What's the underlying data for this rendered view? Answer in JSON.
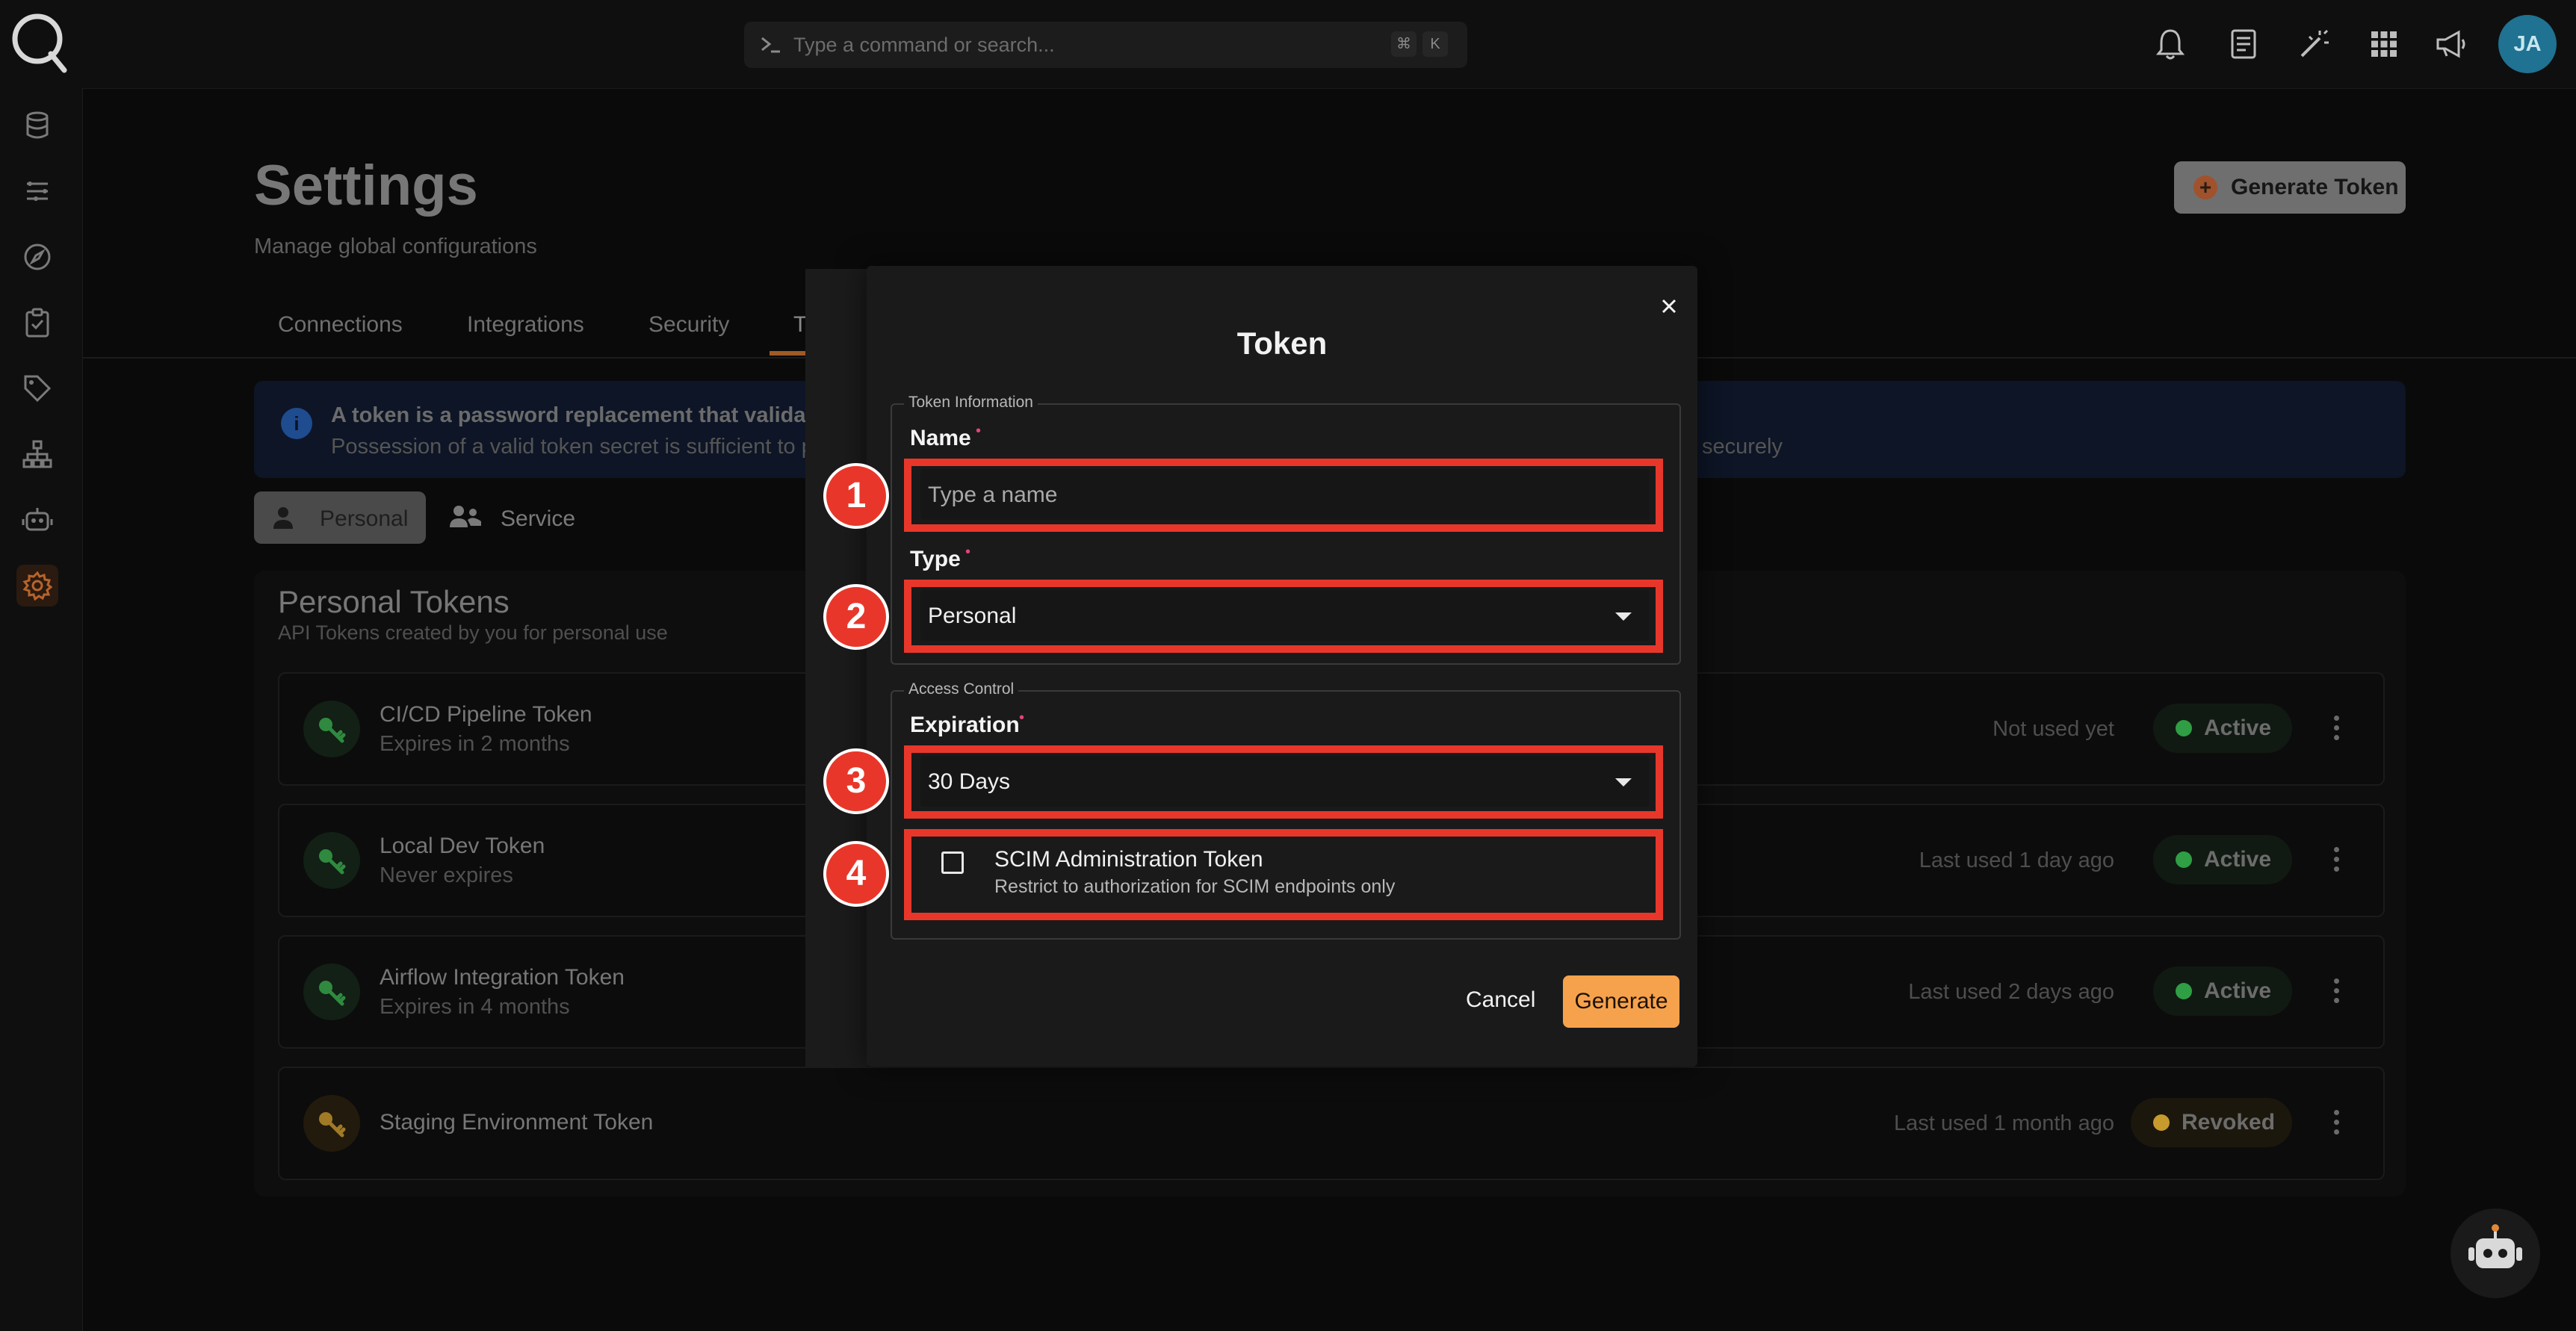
{
  "topbar": {
    "search_placeholder": "Type a command or search...",
    "shortcut_keys": [
      "⌘",
      "K"
    ],
    "icons": [
      "bell-icon",
      "document-icon",
      "magic-wand-icon",
      "apps-grid-icon",
      "megaphone-icon"
    ],
    "avatar_initials": "JA"
  },
  "sidebar": {
    "icons": [
      "database-icon",
      "pipelines-icon",
      "explore-icon",
      "tasks-icon",
      "tags-icon",
      "hierarchy-icon",
      "bot-icon",
      "settings-icon"
    ],
    "active": "settings-icon"
  },
  "page": {
    "title": "Settings",
    "subtitle": "Manage global configurations",
    "generate_button": "Generate Token",
    "tabs": [
      {
        "label": "Connections"
      },
      {
        "label": "Integrations"
      },
      {
        "label": "Security"
      },
      {
        "label": "Tokens",
        "active": true
      }
    ],
    "info_line1": "A token is a password replacement that validates your",
    "info_line2": "Possession of a valid token secret is sufficient to perform",
    "info_line2_tail": "securely",
    "segments": [
      "Personal",
      "Service"
    ],
    "panel_title": "Personal Tokens",
    "panel_subtitle": "API Tokens created by you for personal use",
    "tokens": [
      {
        "name": "CI/CD Pipeline Token",
        "expiry": "Expires in 2 months",
        "used": "Not used yet",
        "status": "Active"
      },
      {
        "name": "Local Dev Token",
        "expiry": "Never expires",
        "used": "Last used 1 day ago",
        "status": "Active"
      },
      {
        "name": "Airflow Integration Token",
        "expiry": "Expires in 4 months",
        "used": "Last used 2 days ago",
        "status": "Active"
      },
      {
        "name": "Staging Environment Token",
        "expiry": "",
        "used": "Last used 1 month ago",
        "status": "Revoked"
      }
    ]
  },
  "modal": {
    "title": "Token",
    "section1": "Token Information",
    "name_label": "Name",
    "name_placeholder": "Type a name",
    "type_label": "Type",
    "type_value": "Personal",
    "section2": "Access Control",
    "expiration_label": "Expiration",
    "expiration_value": "30 Days",
    "scim_title": "SCIM Administration Token",
    "scim_sub": "Restrict to authorization for SCIM endpoints only",
    "scim_checked": false,
    "cancel": "Cancel",
    "generate": "Generate",
    "required_mark": "•"
  },
  "callouts": [
    "1",
    "2",
    "3",
    "4"
  ],
  "colors": {
    "accent": "#f6a24c",
    "callout": "#e8372a",
    "active_dot": "#2f9e44",
    "revoked_dot": "#c79a2e"
  }
}
